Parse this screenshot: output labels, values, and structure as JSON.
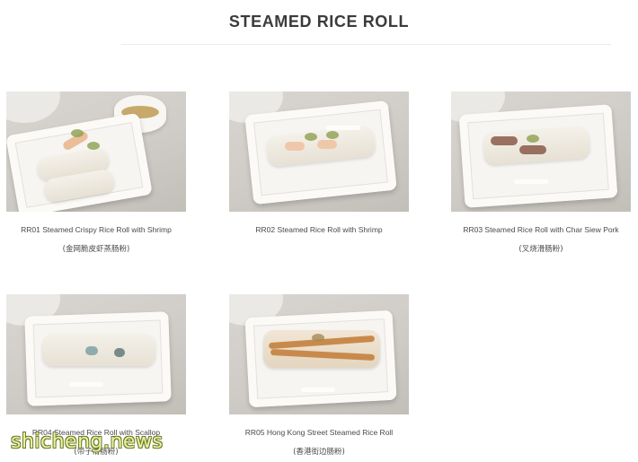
{
  "page": {
    "title": "STEAMED RICE ROLL"
  },
  "items": [
    {
      "code_name": "RR01 Steamed Crispy Rice Roll with Shrimp",
      "cn_name": "(金网脆皮虾蒸肠粉)",
      "photo_label": "rice roll with shrimp photo"
    },
    {
      "code_name": "RR02 Steamed Rice Roll with Shrimp",
      "cn_name": "",
      "photo_label": "rice roll with shrimp photo"
    },
    {
      "code_name": "RR03 Steamed Rice Roll with Char Siew Pork",
      "cn_name": "(叉烧滑肠粉)",
      "photo_label": "rice roll with char siew photo"
    },
    {
      "code_name": "RR04 Steamed Rice Roll with Scallop",
      "cn_name": "(带子滑肠粉)",
      "photo_label": "rice roll with scallop photo"
    },
    {
      "code_name": "RR05 Hong Kong Street Steamed Rice Roll",
      "cn_name": "(香港街边肠粉)",
      "photo_label": "hong kong street rice roll photo"
    }
  ],
  "watermark": {
    "text": "shicheng.news"
  },
  "colors": {
    "title": "#3b3b3b",
    "caption": "#4a4a4a",
    "watermark": "#e8f3a6"
  }
}
